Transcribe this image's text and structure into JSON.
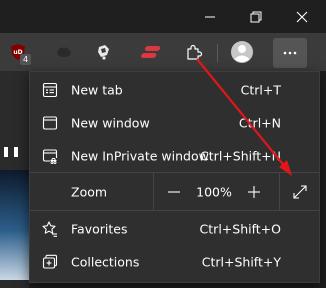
{
  "extension_badge": "4",
  "menu": {
    "items_top": [
      {
        "label": "New tab",
        "shortcut": "Ctrl+T",
        "icon": "new-tab-icon"
      },
      {
        "label": "New window",
        "shortcut": "Ctrl+N",
        "icon": "new-window-icon"
      },
      {
        "label": "New InPrivate window",
        "shortcut": "Ctrl+Shift+N",
        "icon": "inprivate-icon"
      }
    ],
    "zoom": {
      "label": "Zoom",
      "value": "100%"
    },
    "items_bottom": [
      {
        "label": "Favorites",
        "shortcut": "Ctrl+Shift+O",
        "icon": "favorites-icon"
      },
      {
        "label": "Collections",
        "shortcut": "Ctrl+Shift+Y",
        "icon": "collections-icon"
      }
    ]
  },
  "colors": {
    "menu_bg": "#2f2f2f",
    "toolbar_bg": "#3b3b3b",
    "annotation_arrow": "#e0161b"
  }
}
